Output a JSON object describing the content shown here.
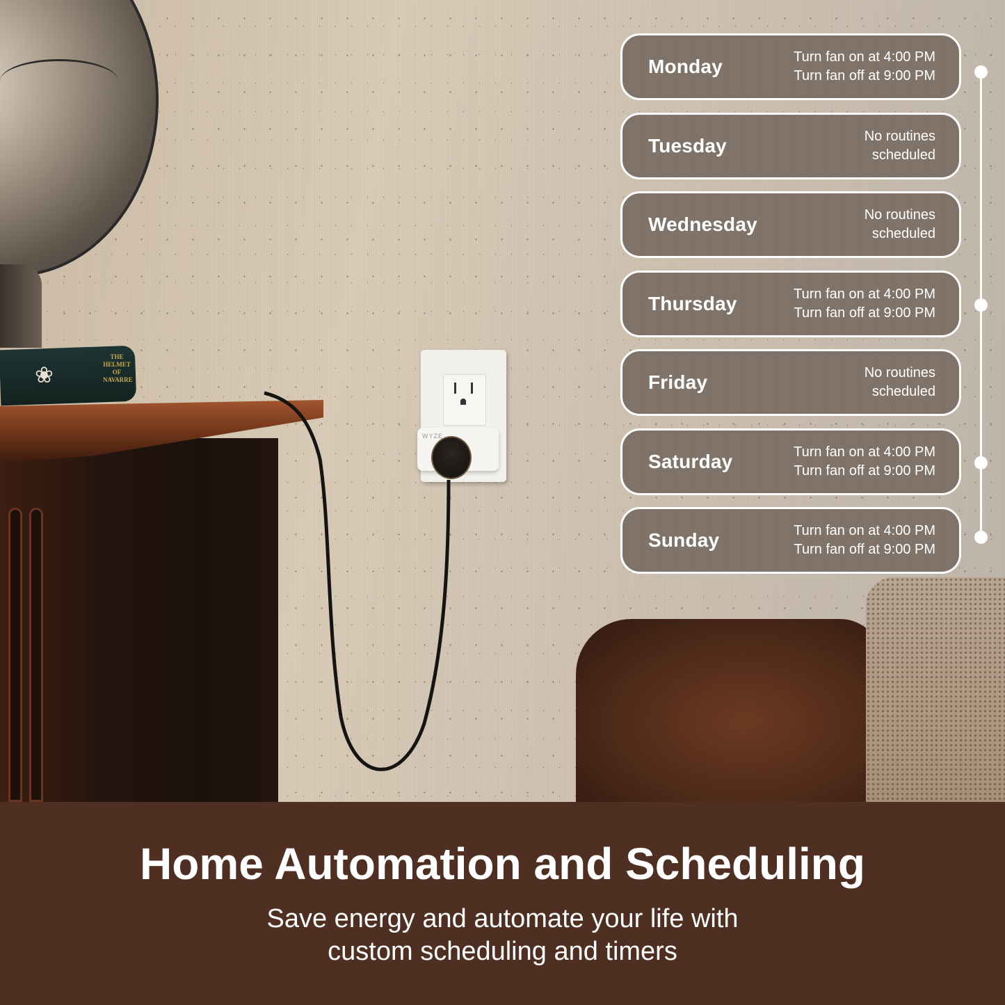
{
  "schedule": {
    "days": [
      {
        "name": "Monday",
        "routine_line1": "Turn fan on at 4:00 PM",
        "routine_line2": "Turn fan off at 9:00 PM",
        "has_routine": true
      },
      {
        "name": "Tuesday",
        "routine_line1": "No routines",
        "routine_line2": "scheduled",
        "has_routine": false
      },
      {
        "name": "Wednesday",
        "routine_line1": "No routines",
        "routine_line2": "scheduled",
        "has_routine": false
      },
      {
        "name": "Thursday",
        "routine_line1": "Turn fan on at 4:00 PM",
        "routine_line2": "Turn fan off at 9:00 PM",
        "has_routine": true
      },
      {
        "name": "Friday",
        "routine_line1": "No routines",
        "routine_line2": "scheduled",
        "has_routine": false
      },
      {
        "name": "Saturday",
        "routine_line1": "Turn fan on at 4:00 PM",
        "routine_line2": "Turn fan off at 9:00 PM",
        "has_routine": true
      },
      {
        "name": "Sunday",
        "routine_line1": "Turn fan on at 4:00 PM",
        "routine_line2": "Turn fan off at 9:00 PM",
        "has_routine": true
      }
    ]
  },
  "scene": {
    "book_title": "THE HELMET OF NAVARRE",
    "plug_brand": "WYZE"
  },
  "footer": {
    "headline": "Home Automation and Scheduling",
    "subline_1": "Save energy and automate your life with",
    "subline_2": "custom scheduling and timers"
  },
  "colors": {
    "card_fill": "#7e7167",
    "card_border": "#ffffff",
    "footer_bg": "#4e2f22",
    "text": "#ffffff"
  }
}
